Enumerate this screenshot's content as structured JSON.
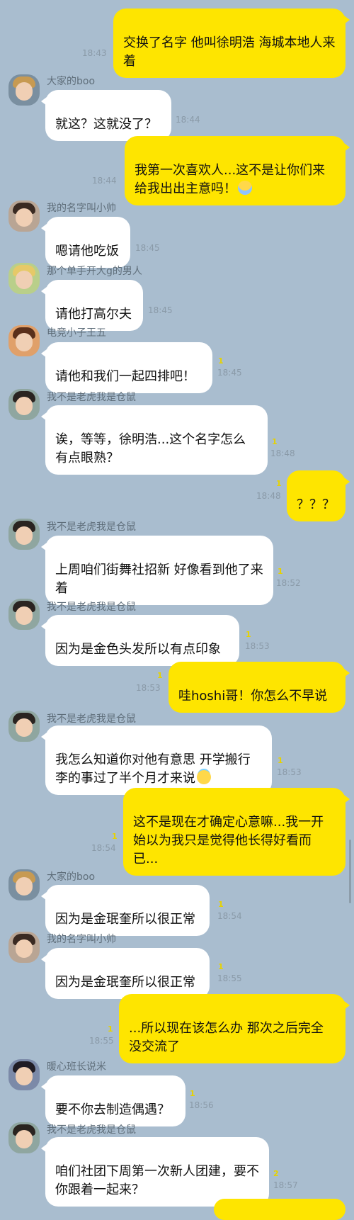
{
  "colors": {
    "background": "#a9bdcf",
    "outgoing_bubble": "#fee500",
    "incoming_bubble": "#ffffff",
    "unread": "#e6d200"
  },
  "messages": [
    {
      "dir": "out",
      "text": "交换了名字 他叫徐明浩 海城本地人来着",
      "time": "18:43"
    },
    {
      "dir": "in",
      "sender": "大家的boo",
      "text": "就这？这就没了？",
      "time": "18:44"
    },
    {
      "dir": "out",
      "text": "我第一次喜欢人...这不是让你们来给我出出主意吗！",
      "emoji": "face-screaming-in-fear",
      "time": "18:44"
    },
    {
      "dir": "in",
      "sender": "我的名字叫小帅",
      "text": "嗯请他吃饭",
      "time": "18:45"
    },
    {
      "dir": "in",
      "sender": "那个单手开大g的男人",
      "text": "请他打高尔夫",
      "time": "18:45"
    },
    {
      "dir": "in",
      "sender": "电竞小子王五",
      "text": "请他和我们一起四排吧！",
      "time": "18:45",
      "unread": "1"
    },
    {
      "dir": "in",
      "sender": "我不是老虎我是仓鼠",
      "text": "诶，等等，徐明浩...这个名字怎么有点眼熟？",
      "time": "18:48",
      "unread": "1"
    },
    {
      "dir": "out",
      "text": "？？？",
      "time": "18:48",
      "unread": "1"
    },
    {
      "dir": "in",
      "sender": "我不是老虎我是仓鼠",
      "text": "上周咱们街舞社招新 好像看到他了来着",
      "time": "18:52",
      "unread": "1"
    },
    {
      "dir": "in",
      "sender": "我不是老虎我是仓鼠",
      "text": "因为是金色头发所以有点印象",
      "time": "18:53",
      "unread": "1"
    },
    {
      "dir": "out",
      "text": "哇hoshi哥！你怎么不早说",
      "time": "18:53",
      "unread": "1"
    },
    {
      "dir": "in",
      "sender": "我不是老虎我是仓鼠",
      "text": "我怎么知道你对他有意思 开学搬行李的事过了半个月才来说",
      "emoji": "smiling-face-with-halo",
      "time": "18:53",
      "unread": "1"
    },
    {
      "dir": "out",
      "text": "这不是现在才确定心意嘛...我一开始以为我只是觉得他长得好看而已...",
      "time": "18:54",
      "unread": "1"
    },
    {
      "dir": "in",
      "sender": "大家的boo",
      "text": "因为是金珉奎所以很正常",
      "time": "18:54",
      "unread": "1"
    },
    {
      "dir": "in",
      "sender": "我的名字叫小帅",
      "text": "因为是金珉奎所以很正常",
      "time": "18:55",
      "unread": "1"
    },
    {
      "dir": "out",
      "text": "...所以现在该怎么办 那次之后完全没交流了",
      "time": "18:55",
      "unread": "1"
    },
    {
      "dir": "in",
      "sender": "暖心班长说米",
      "text": "要不你去制造偶遇？",
      "time": "18:56",
      "unread": "1"
    },
    {
      "dir": "in",
      "sender": "我不是老虎我是仓鼠",
      "text": "咱们社团下周第一次新人团建，要不你跟着一起来？",
      "time": "18:57",
      "unread": "2"
    }
  ]
}
